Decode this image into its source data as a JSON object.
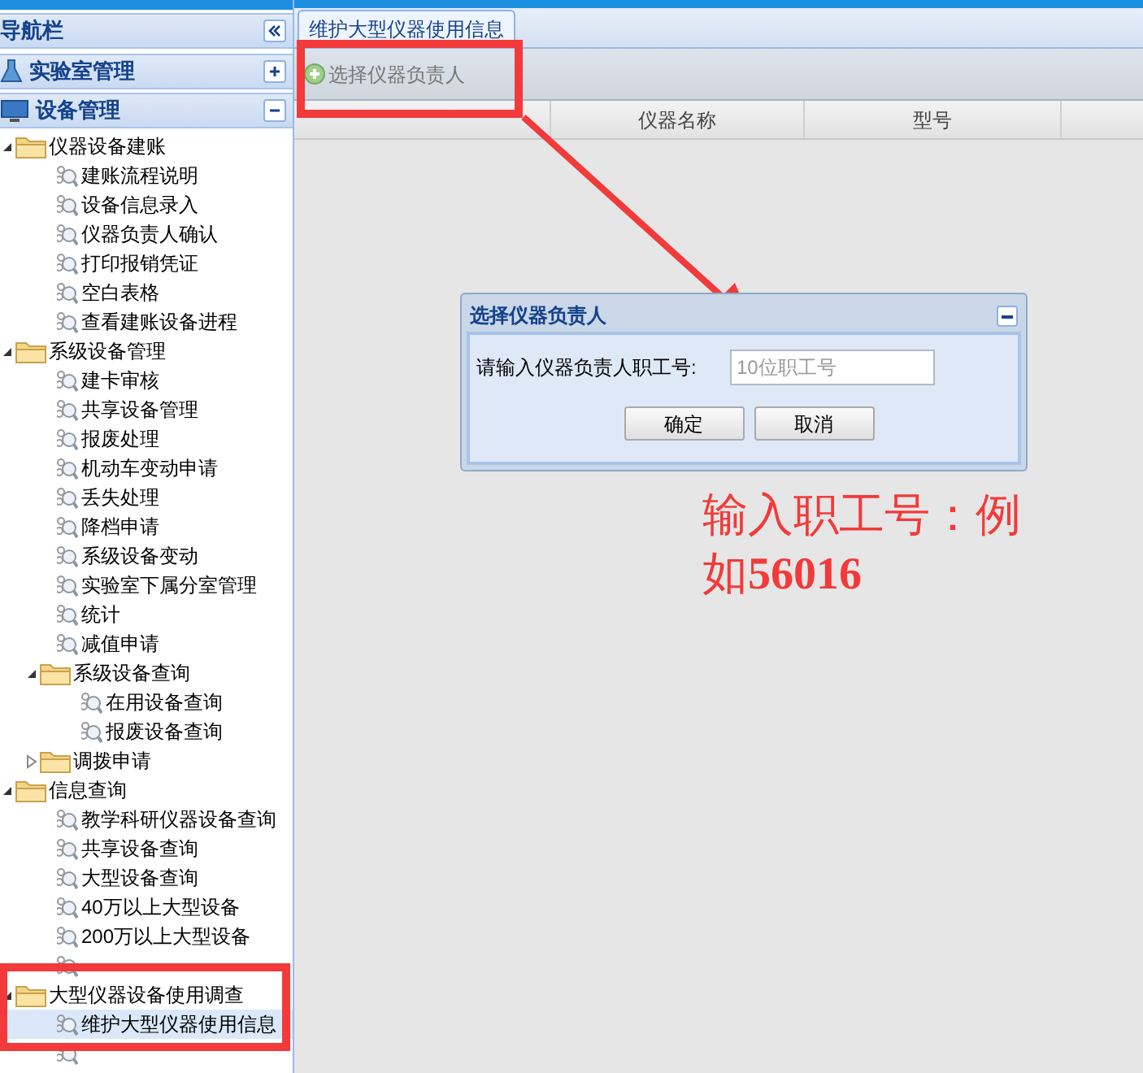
{
  "sidebar": {
    "title": "导航栏",
    "sections": [
      {
        "label": "实验室管理",
        "expanded": false
      },
      {
        "label": "设备管理",
        "expanded": true
      }
    ],
    "tree": [
      {
        "label": "仪器设备建账",
        "expanded": true,
        "children": [
          {
            "label": "建账流程说明",
            "selected": false
          },
          {
            "label": "设备信息录入",
            "selected": false
          },
          {
            "label": "仪器负责人确认",
            "selected": false
          },
          {
            "label": "打印报销凭证",
            "selected": false
          },
          {
            "label": "空白表格",
            "selected": false
          },
          {
            "label": "查看建账设备进程",
            "selected": false
          }
        ]
      },
      {
        "label": "系级设备管理",
        "expanded": true,
        "children": [
          {
            "label": "建卡审核",
            "selected": false
          },
          {
            "label": "共享设备管理",
            "selected": false
          },
          {
            "label": "报废处理",
            "selected": false
          },
          {
            "label": "机动车变动申请",
            "selected": false
          },
          {
            "label": "丢失处理",
            "selected": false
          },
          {
            "label": "降档申请",
            "selected": false
          },
          {
            "label": "系级设备变动",
            "selected": false
          },
          {
            "label": "实验室下属分室管理",
            "selected": false
          },
          {
            "label": "统计",
            "selected": false
          },
          {
            "label": "减值申请",
            "selected": false
          },
          {
            "label": "系级设备查询",
            "expanded": true,
            "children": [
              {
                "label": "在用设备查询",
                "selected": false
              },
              {
                "label": "报废设备查询",
                "selected": false
              }
            ]
          },
          {
            "label": "调拨申请",
            "expanded": false
          }
        ]
      },
      {
        "label": "信息查询",
        "expanded": true,
        "children": [
          {
            "label": "教学科研仪器设备查询",
            "selected": false
          },
          {
            "label": "共享设备查询",
            "selected": false
          },
          {
            "label": "大型设备查询",
            "selected": false
          },
          {
            "label": "40万以上大型设备",
            "selected": false
          },
          {
            "label": "200万以上大型设备",
            "selected": false
          },
          {
            "selected": false
          }
        ]
      },
      {
        "label": "大型仪器设备使用调查",
        "expanded": true,
        "children": [
          {
            "label": "维护大型仪器使用信息",
            "selected": true
          },
          {
            "selected": false
          }
        ]
      }
    ]
  },
  "tabs": [
    {
      "label": "维护大型仪器使用信息",
      "selected": true
    }
  ],
  "toolbar": {
    "button": "选择仪器负责人"
  },
  "table": {
    "columns": [
      {},
      {
        "label": "仪器名称"
      },
      {
        "label": "型号"
      }
    ]
  },
  "dialog": {
    "title": "选择仪器负责人",
    "label": "请输入仪器负责人职工号:",
    "placeholder": "10位职工号",
    "buttons": [
      "确定",
      "取消"
    ]
  },
  "annotation": {
    "text": "输入职工号：例如**56016**"
  }
}
